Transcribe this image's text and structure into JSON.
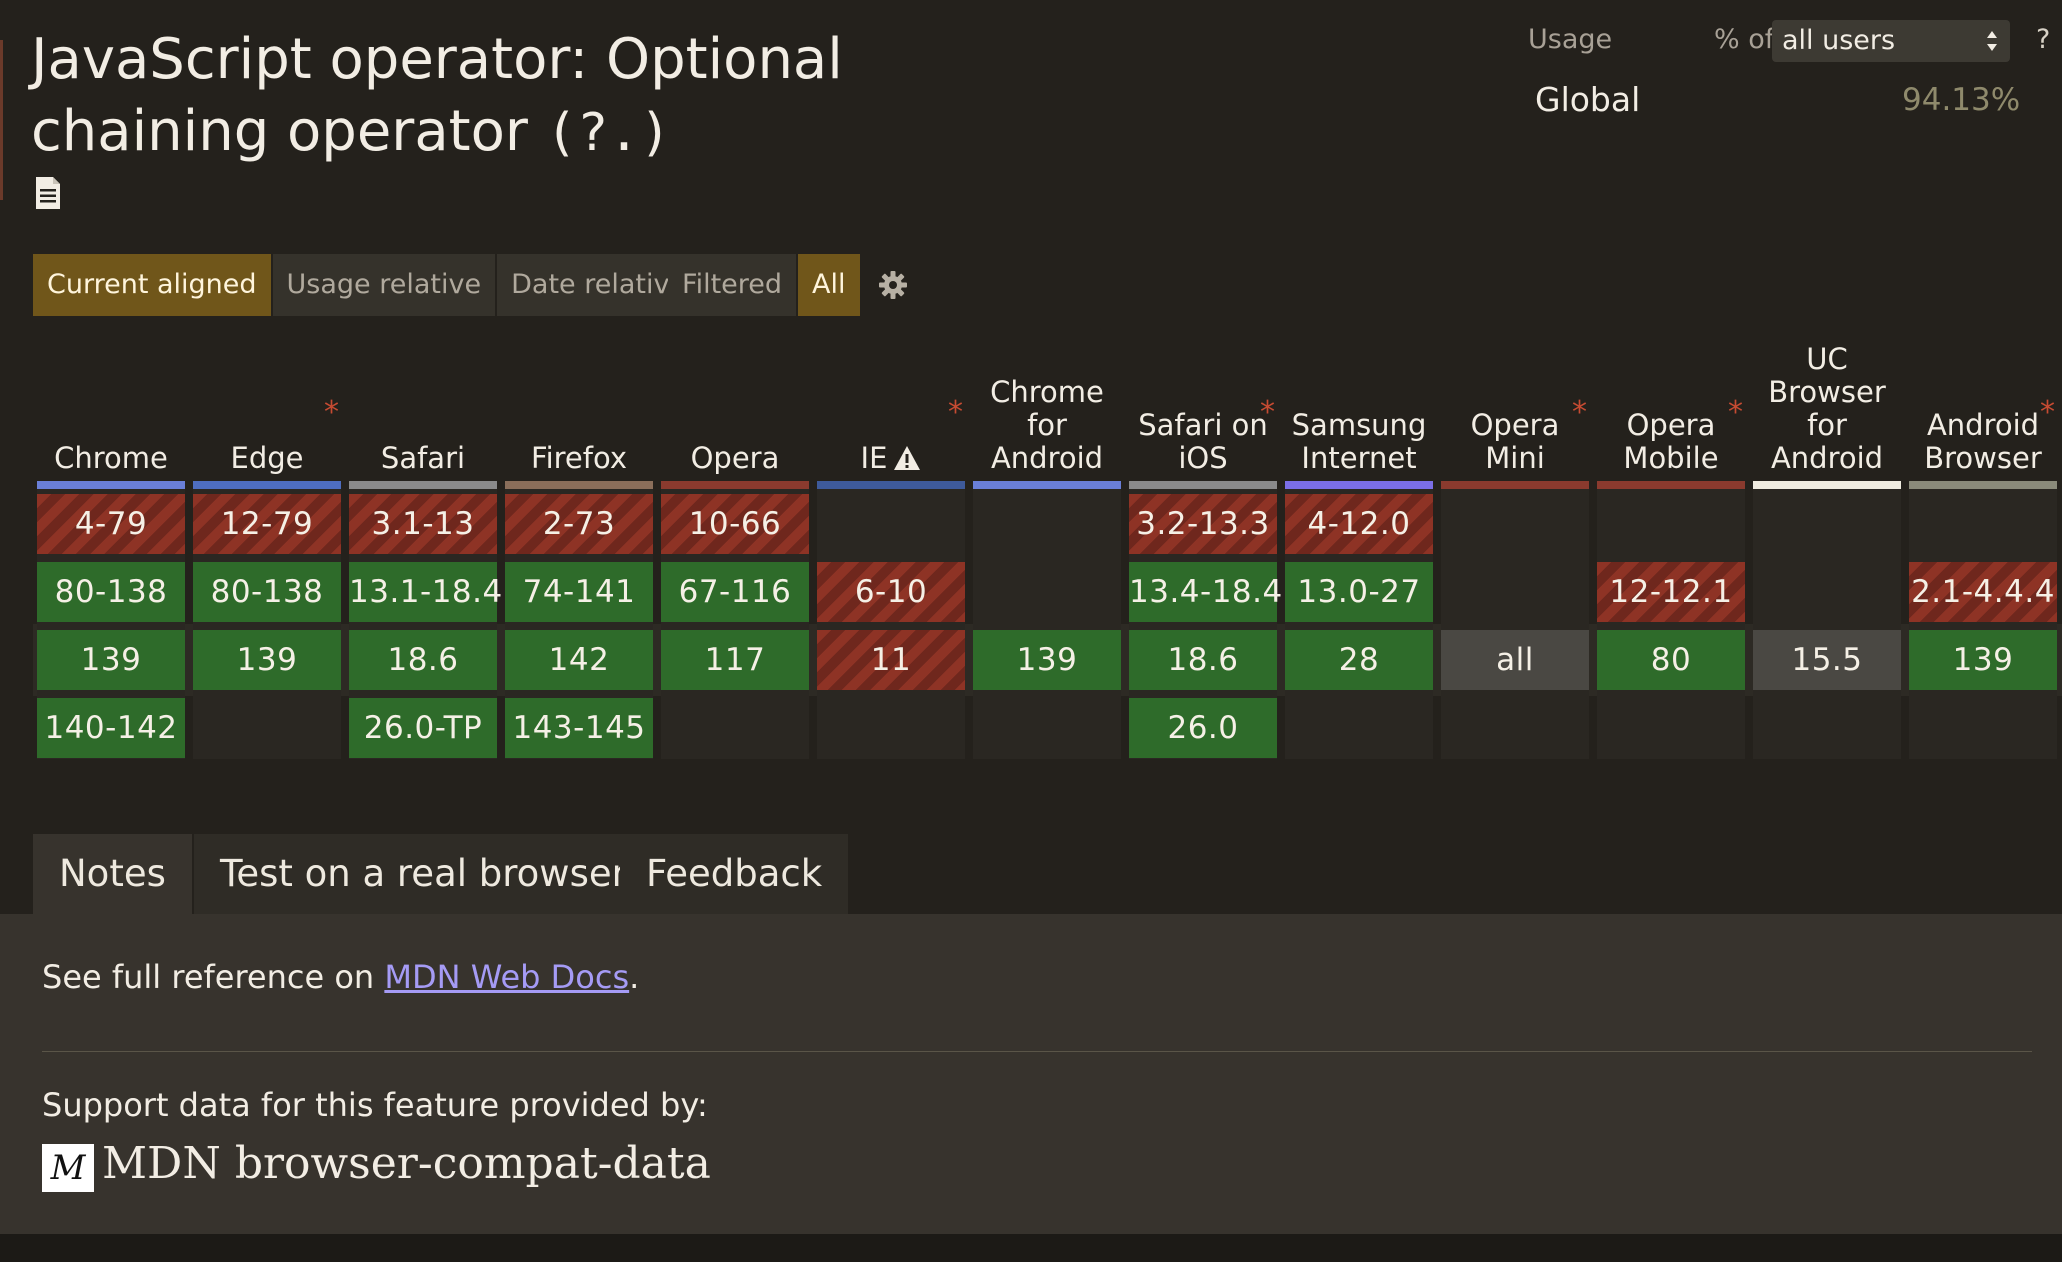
{
  "title": {
    "prefix": "JavaScript operator: Optional chaining operator",
    "code": "(?.)"
  },
  "usage": {
    "label": "Usage",
    "pct_of": "% of",
    "selected": "all users",
    "help": "?",
    "region": "Global",
    "value": "94.13%"
  },
  "views": {
    "group1": [
      "Current aligned",
      "Usage relative",
      "Date relative"
    ],
    "group2": [
      "Filtered",
      "All"
    ],
    "active1": "Current aligned",
    "active2": "All"
  },
  "colors": {
    "supported": "#2e6b2a",
    "unsupported": "#8e3325",
    "unknown": "#4a4843",
    "accent": "#70561a"
  },
  "browsers": [
    {
      "name": "Chrome",
      "asterisk": false,
      "bar": "#6a7fd8",
      "cells": [
        {
          "r": 0,
          "v": "4-79",
          "s": "n"
        },
        {
          "r": 1,
          "v": "80-138",
          "s": "y"
        },
        {
          "r": 2,
          "v": "139",
          "s": "y"
        },
        {
          "r": 3,
          "v": "140-142",
          "s": "y"
        }
      ]
    },
    {
      "name": "Edge",
      "asterisk": true,
      "bar": "#4e6dbf",
      "cells": [
        {
          "r": 0,
          "v": "12-79",
          "s": "n"
        },
        {
          "r": 1,
          "v": "80-138",
          "s": "y"
        },
        {
          "r": 2,
          "v": "139",
          "s": "y"
        }
      ]
    },
    {
      "name": "Safari",
      "asterisk": false,
      "bar": "#8a8a8a",
      "cells": [
        {
          "r": 0,
          "v": "3.1-13",
          "s": "n"
        },
        {
          "r": 1,
          "v": "13.1-18.4",
          "s": "y"
        },
        {
          "r": 2,
          "v": "18.6",
          "s": "y"
        },
        {
          "r": 3,
          "v": "26.0-TP",
          "s": "y"
        }
      ]
    },
    {
      "name": "Firefox",
      "asterisk": false,
      "bar": "#8a6e5a",
      "cells": [
        {
          "r": 0,
          "v": "2-73",
          "s": "n"
        },
        {
          "r": 1,
          "v": "74-141",
          "s": "y"
        },
        {
          "r": 2,
          "v": "142",
          "s": "y"
        },
        {
          "r": 3,
          "v": "143-145",
          "s": "y"
        }
      ]
    },
    {
      "name": "Opera",
      "asterisk": false,
      "bar": "#8a3a2e",
      "cells": [
        {
          "r": 0,
          "v": "10-66",
          "s": "n"
        },
        {
          "r": 1,
          "v": "67-116",
          "s": "y"
        },
        {
          "r": 2,
          "v": "117",
          "s": "y"
        }
      ]
    },
    {
      "name": "IE",
      "asterisk": true,
      "warn": true,
      "bar": "#3e5a9a",
      "cells": [
        {
          "r": 1,
          "v": "6-10",
          "s": "n"
        },
        {
          "r": 2,
          "v": "11",
          "s": "n"
        }
      ]
    },
    {
      "name": "Chrome for Android",
      "asterisk": false,
      "bar": "#6a7fd8",
      "cells": [
        {
          "r": 2,
          "v": "139",
          "s": "y"
        }
      ]
    },
    {
      "name": "Safari on iOS",
      "asterisk": true,
      "bar": "#8a8a8a",
      "cells": [
        {
          "r": 0,
          "v": "3.2-13.3",
          "s": "n"
        },
        {
          "r": 1,
          "v": "13.4-18.4",
          "s": "y"
        },
        {
          "r": 2,
          "v": "18.6",
          "s": "y"
        },
        {
          "r": 3,
          "v": "26.0",
          "s": "y"
        }
      ]
    },
    {
      "name": "Samsung Internet",
      "asterisk": false,
      "bar": "#7b6ee6",
      "cells": [
        {
          "r": 0,
          "v": "4-12.0",
          "s": "n"
        },
        {
          "r": 1,
          "v": "13.0-27",
          "s": "y"
        },
        {
          "r": 2,
          "v": "28",
          "s": "y"
        }
      ]
    },
    {
      "name": "Opera Mini",
      "asterisk": true,
      "bar": "#8a3a2e",
      "cells": [
        {
          "r": 2,
          "v": "all",
          "s": "u"
        }
      ]
    },
    {
      "name": "Opera Mobile",
      "asterisk": true,
      "bar": "#8a3a2e",
      "cells": [
        {
          "r": 1,
          "v": "12-12.1",
          "s": "n"
        },
        {
          "r": 2,
          "v": "80",
          "s": "y"
        }
      ]
    },
    {
      "name": "UC Browser for Android",
      "asterisk": false,
      "bar": "#f0ece0",
      "cells": [
        {
          "r": 2,
          "v": "15.5",
          "s": "u"
        }
      ]
    },
    {
      "name": "Android Browser",
      "asterisk": true,
      "bar": "#8a8a7a",
      "cells": [
        {
          "r": 1,
          "v": "2.1-4.4.4",
          "s": "n"
        },
        {
          "r": 2,
          "v": "139",
          "s": "y"
        }
      ]
    }
  ],
  "tabs": [
    "Notes",
    "Test on a real browser",
    "Feedback"
  ],
  "notes": {
    "prefix": "See full reference on ",
    "link": "MDN Web Docs",
    "suffix": "."
  },
  "support": {
    "label": "Support data for this feature provided by:",
    "logo": "M",
    "provider": "MDN browser-compat-data"
  }
}
